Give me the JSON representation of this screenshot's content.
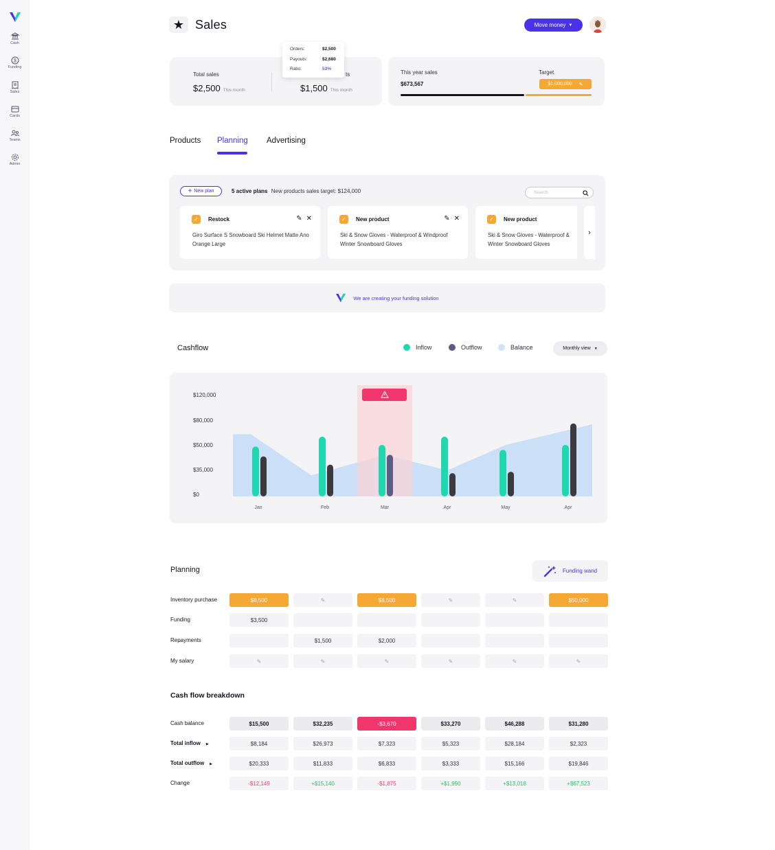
{
  "sidebar": {
    "items": [
      {
        "label": "Cash",
        "icon": "bank-icon"
      },
      {
        "label": "Funding",
        "icon": "dollar-gear-icon"
      },
      {
        "label": "Sales",
        "icon": "receipt-icon"
      },
      {
        "label": "Cards",
        "icon": "card-icon"
      },
      {
        "label": "Teams",
        "icon": "team-icon"
      },
      {
        "label": "Admin",
        "icon": "gear-icon"
      }
    ]
  },
  "header": {
    "title": "Sales",
    "move_money": "Move money"
  },
  "summary": {
    "total_sales_label": "Total sales",
    "total_sales_value": "$2,500",
    "this_month": "This month",
    "second_label_tail": "ts",
    "second_value": "$1,500",
    "second_this_month": "This month",
    "tooltip": {
      "orders_label": "Orders:",
      "orders_value": "$2,500",
      "payouts_label": "Payouts:",
      "payouts_value": "$2,680",
      "ratio_label": "Ratio:",
      "ratio_value": "53%"
    },
    "year_sales_label": "This year sales",
    "year_sales_value": "$673,567",
    "target_label": "Target",
    "target_value": "$1,000,000",
    "progress_fraction": 0.674
  },
  "tabs": [
    {
      "label": "Products"
    },
    {
      "label": "Planning"
    },
    {
      "label": "Advertising"
    }
  ],
  "plans": {
    "new_plan": "New plan",
    "active_count": "5 active plans",
    "target_text": "New products sales target: $124,000",
    "search_placeholder": "Search",
    "cards": [
      {
        "title": "Restock",
        "desc": "Giro Surface S Snowboard Ski Helmet Matte Ano Orange Large"
      },
      {
        "title": "New product",
        "desc": "Ski & Snow Gloves - Waterproof & Windproof Winter Snowboard Gloves"
      },
      {
        "title": "New product",
        "desc": "Ski & Snow Gloves - Waterproof & Winter Snowboard Gloves"
      }
    ]
  },
  "funding_banner": "We are creating your funding solution",
  "cashflow": {
    "title": "Cashflow",
    "legend": [
      "Inflow",
      "Outflow",
      "Balance"
    ],
    "view": "Monthly view"
  },
  "chart_data": {
    "type": "bar",
    "categories": [
      "Jan",
      "Feb",
      "Mar",
      "Apr",
      "May",
      "Apr"
    ],
    "y_tick_labels": [
      "$120,000",
      "$80,000",
      "$50,000",
      "$35,000",
      "$0"
    ],
    "series": [
      {
        "name": "Inflow",
        "values": [
          49000,
          60000,
          50000,
          60000,
          47000,
          50000
        ],
        "color": "#1fd8b0"
      },
      {
        "name": "Outflow",
        "values": [
          43000,
          38000,
          44000,
          30000,
          32000,
          76000
        ],
        "color": "#3a3a3f"
      },
      {
        "name": "Balance",
        "values": [
          63000,
          27000,
          44000,
          34000,
          50000,
          75000
        ],
        "color": "#c7def7"
      }
    ],
    "highlight_category": "Mar",
    "colors": {
      "inflow": "#1fd8b0",
      "outflow": "#3a3a3f",
      "balance": "#c7def7",
      "warning": "#f0366b",
      "warning_bg": "#f9d5d8"
    }
  },
  "planning": {
    "title": "Planning",
    "wand": "Funding wand",
    "rows": [
      {
        "label": "Inventory purchase",
        "cells": [
          {
            "v": "$8,500",
            "t": "orange"
          },
          {
            "v": "",
            "t": "edit"
          },
          {
            "v": "$8,500",
            "t": "orange"
          },
          {
            "v": "",
            "t": "edit"
          },
          {
            "v": "",
            "t": "edit"
          },
          {
            "v": "$50,000",
            "t": "orange"
          }
        ]
      },
      {
        "label": "Funding",
        "cells": [
          {
            "v": "$3,500",
            "t": ""
          },
          {
            "v": "",
            "t": ""
          },
          {
            "v": "",
            "t": ""
          },
          {
            "v": "",
            "t": ""
          },
          {
            "v": "",
            "t": ""
          },
          {
            "v": "",
            "t": ""
          }
        ]
      },
      {
        "label": "Repayments",
        "cells": [
          {
            "v": "",
            "t": ""
          },
          {
            "v": "$1,500",
            "t": ""
          },
          {
            "v": "$2,000",
            "t": ""
          },
          {
            "v": "",
            "t": ""
          },
          {
            "v": "",
            "t": ""
          },
          {
            "v": "",
            "t": ""
          }
        ]
      },
      {
        "label": "My salary",
        "cells": [
          {
            "v": "",
            "t": "edit"
          },
          {
            "v": "",
            "t": "edit"
          },
          {
            "v": "",
            "t": "edit"
          },
          {
            "v": "",
            "t": "edit"
          },
          {
            "v": "",
            "t": "edit"
          },
          {
            "v": "",
            "t": "edit"
          }
        ]
      }
    ]
  },
  "breakdown": {
    "title": "Cash flow breakdown",
    "rows": [
      {
        "label": "Cash balance",
        "bold": false,
        "cells": [
          {
            "v": "$15,500",
            "t": "strong"
          },
          {
            "v": "$32,235",
            "t": "strong"
          },
          {
            "v": "-$3,670",
            "t": "pink"
          },
          {
            "v": "$33,270",
            "t": "strong"
          },
          {
            "v": "$46,288",
            "t": "strong"
          },
          {
            "v": "$31,280",
            "t": "strong"
          }
        ]
      },
      {
        "label": "Total inflow",
        "bold": true,
        "cells": [
          {
            "v": "$8,184",
            "t": ""
          },
          {
            "v": "$26,973",
            "t": ""
          },
          {
            "v": "$7,323",
            "t": ""
          },
          {
            "v": "$5,323",
            "t": ""
          },
          {
            "v": "$28,184",
            "t": ""
          },
          {
            "v": "$2,323",
            "t": ""
          }
        ]
      },
      {
        "label": "Total outflow",
        "bold": true,
        "cells": [
          {
            "v": "$20,333",
            "t": ""
          },
          {
            "v": "$11,833",
            "t": ""
          },
          {
            "v": "$6,833",
            "t": ""
          },
          {
            "v": "$3,333",
            "t": ""
          },
          {
            "v": "$15,166",
            "t": ""
          },
          {
            "v": "$19,846",
            "t": ""
          }
        ]
      },
      {
        "label": "Change",
        "bold": false,
        "cells": [
          {
            "v": "-$12,149",
            "t": "neg"
          },
          {
            "v": "+$15,140",
            "t": "pos"
          },
          {
            "v": "-$1,875",
            "t": "neg"
          },
          {
            "v": "+$1,990",
            "t": "pos"
          },
          {
            "v": "+$13,018",
            "t": "pos"
          },
          {
            "v": "+$67,523",
            "t": "pos"
          }
        ]
      }
    ]
  }
}
